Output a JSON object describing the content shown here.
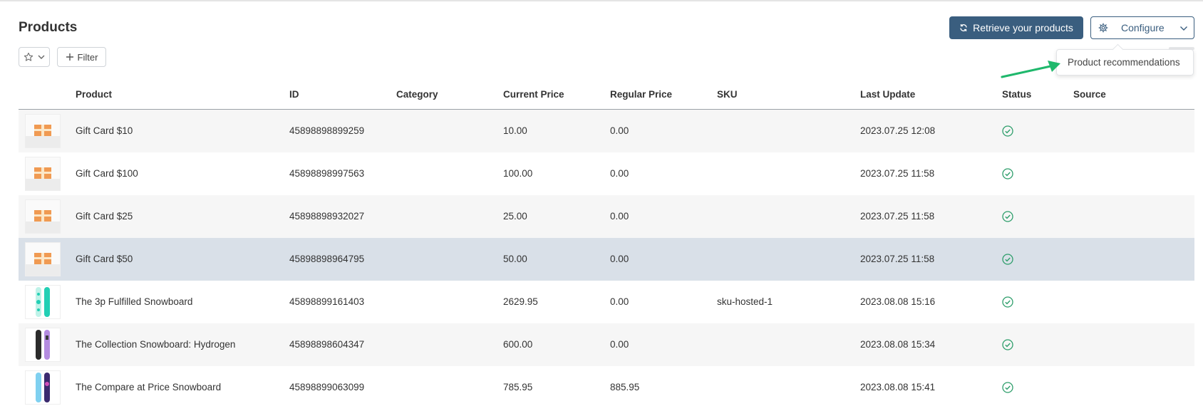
{
  "page": {
    "title": "Products"
  },
  "toolbar": {
    "filter_label": "Filter",
    "retrieve_label": "Retrieve your products",
    "configure_label": "Configure",
    "icons": {
      "favorites": "star-icon",
      "dropdown": "chevron-down-icon",
      "add": "plus-icon",
      "refresh": "refresh-icon",
      "settings": "gear-icon"
    }
  },
  "popup": {
    "label": "Product recommendations"
  },
  "colors": {
    "primary": "#3a5e7f",
    "status_ok": "#2e9e6b",
    "arrow": "#1fb86c",
    "row_selected": "#d9e0e8"
  },
  "table": {
    "columns": {
      "product": "Product",
      "id": "ID",
      "category": "Category",
      "current_price": "Current Price",
      "regular_price": "Regular Price",
      "sku": "SKU",
      "last_update": "Last Update",
      "status": "Status",
      "source": "Source"
    },
    "rows": [
      {
        "thumb": "gift-card",
        "product": "Gift Card $10",
        "id": "45898898899259",
        "category": "",
        "current_price": "10.00",
        "regular_price": "0.00",
        "sku": "",
        "last_update": "2023.07.25 12:08",
        "status": "check-circle-icon",
        "source": ""
      },
      {
        "thumb": "gift-card",
        "product": "Gift Card $100",
        "id": "45898898997563",
        "category": "",
        "current_price": "100.00",
        "regular_price": "0.00",
        "sku": "",
        "last_update": "2023.07.25 11:58",
        "status": "check-circle-icon",
        "source": ""
      },
      {
        "thumb": "gift-card",
        "product": "Gift Card $25",
        "id": "45898898932027",
        "category": "",
        "current_price": "25.00",
        "regular_price": "0.00",
        "sku": "",
        "last_update": "2023.07.25 11:58",
        "status": "check-circle-icon",
        "source": ""
      },
      {
        "thumb": "gift-card",
        "product": "Gift Card $50",
        "id": "45898898964795",
        "category": "",
        "current_price": "50.00",
        "regular_price": "0.00",
        "sku": "",
        "last_update": "2023.07.25 11:58",
        "status": "check-circle-icon",
        "source": ""
      },
      {
        "thumb": "snowboard-teal",
        "product": "The 3p Fulfilled Snowboard",
        "id": "45898899161403",
        "category": "",
        "current_price": "2629.95",
        "regular_price": "0.00",
        "sku": "sku-hosted-1",
        "last_update": "2023.08.08 15:16",
        "status": "check-circle-icon",
        "source": ""
      },
      {
        "thumb": "snowboard-purple",
        "product": "The Collection Snowboard: Hydrogen",
        "id": "45898898604347",
        "category": "",
        "current_price": "600.00",
        "regular_price": "0.00",
        "sku": "",
        "last_update": "2023.08.08 15:34",
        "status": "check-circle-icon",
        "source": ""
      },
      {
        "thumb": "snowboard-blue",
        "product": "The Compare at Price Snowboard",
        "id": "45898899063099",
        "category": "",
        "current_price": "785.95",
        "regular_price": "885.95",
        "sku": "",
        "last_update": "2023.08.08 15:41",
        "status": "check-circle-icon",
        "source": ""
      }
    ]
  }
}
